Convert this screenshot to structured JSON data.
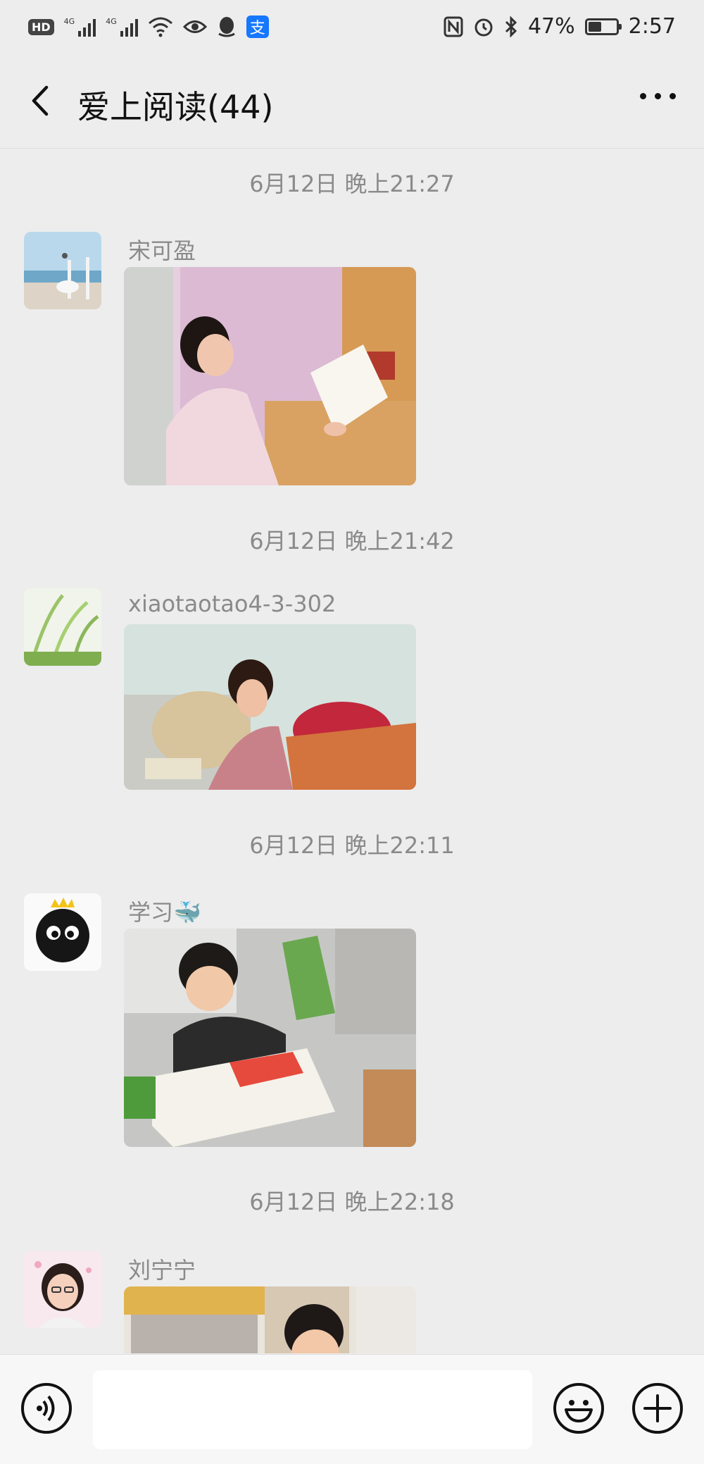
{
  "status_bar": {
    "hd_label": "HD",
    "network_1": "4G",
    "network_2": "4G",
    "battery_percent": "47%",
    "battery_level": 0.47,
    "time": "2:57",
    "icons": [
      "hd-icon",
      "signal-icon",
      "signal-icon",
      "wifi-icon",
      "eye-icon",
      "qq-icon",
      "alipay-icon",
      "nfc-icon",
      "alarm-icon",
      "bluetooth-icon",
      "battery-icon"
    ]
  },
  "nav": {
    "title": "爱上阅读(44)",
    "back_icon": "chevron-left-icon",
    "more_icon": "more-dots-icon"
  },
  "messages": [
    {
      "timestamp": "6月12日 晚上21:27",
      "sender": "宋可盈",
      "content_type": "image"
    },
    {
      "timestamp": "6月12日 晚上21:42",
      "sender": "xiaotaotao4-3-302",
      "content_type": "image"
    },
    {
      "timestamp": "6月12日 晚上22:11",
      "sender": "学习🐳",
      "content_type": "image"
    },
    {
      "timestamp": "6月12日 晚上22:18",
      "sender": "刘宁宁",
      "content_type": "image"
    }
  ],
  "input_bar": {
    "input_value": "",
    "voice_icon": "voice-icon",
    "emoji_icon": "emoji-icon",
    "plus_icon": "plus-icon"
  }
}
